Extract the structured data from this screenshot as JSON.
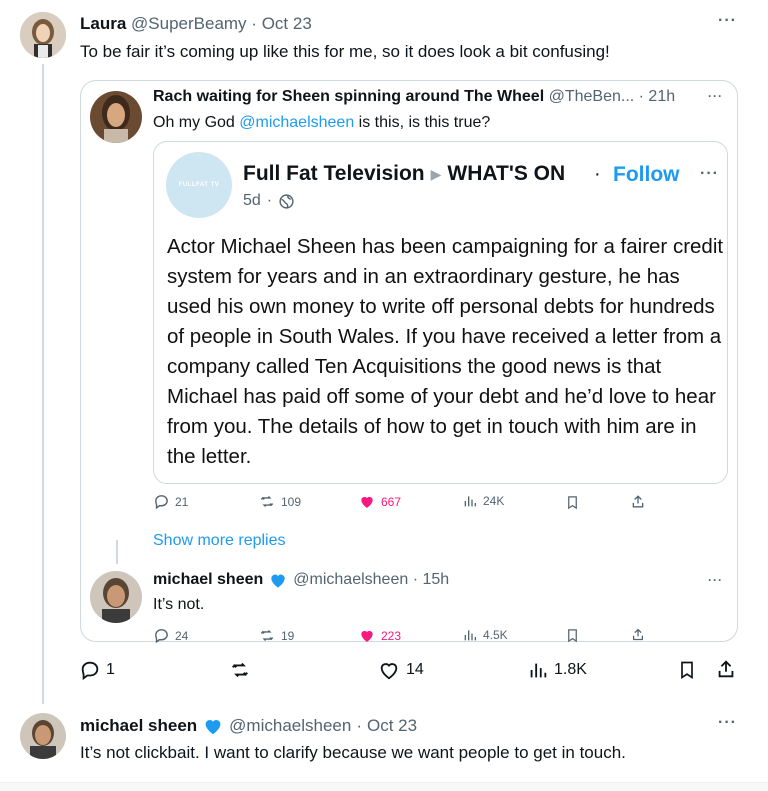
{
  "tweet1": {
    "name": "Laura",
    "handle": "@SuperBeamy",
    "sep": "·",
    "time": "Oct 23",
    "text": "To be fair it’s coming up like this for me, so it does look a bit confusing!",
    "more": "···"
  },
  "quoted": {
    "name": "Rach waiting for Sheen spinning around The Wheel",
    "handle_time": "@TheBen... · 21h",
    "more": "···",
    "text_prefix": "Oh my God ",
    "mention": "@michaelsheen",
    "text_suffix": " is this, is this true?"
  },
  "embedded": {
    "avatar_text": "FULLFAT TV",
    "name": "Full Fat Television",
    "arrow": "▶",
    "community": "WHAT'S ON",
    "dot": "·",
    "follow": "Follow",
    "more": "···",
    "time": "5d",
    "sep": "·",
    "body": "Actor Michael Sheen has been campaigning for a fairer credit system for years and in an extraordinary gesture, he has used his own money to write off personal debts for hundreds of people in South Wales. If you have received a letter from a company called Ten Acquisitions the good news is that Michael has paid off some of your debt and he’d love to hear from you.  The details of how to get in touch with him are in the letter."
  },
  "quoted_actions": {
    "replies": "21",
    "reposts": "109",
    "likes": "667",
    "views": "24K"
  },
  "show_more": "Show more replies",
  "reply": {
    "name": "michael sheen",
    "handle_time": "@michaelsheen · 15h",
    "more": "···",
    "text": "It’s not.",
    "replies": "24",
    "reposts": "19",
    "likes": "223",
    "views": "4.5K"
  },
  "tweet1_actions": {
    "replies": "1",
    "likes": "14",
    "views": "1.8K"
  },
  "tweet2": {
    "name": "michael sheen",
    "handle": "@michaelsheen",
    "sep": "·",
    "time": "Oct 23",
    "text": "It’s not clickbait. I want to clarify because we want people to get in touch.",
    "more": "···"
  },
  "colors": {
    "accent": "#1d9bf0",
    "like": "#f91880",
    "muted": "#536471",
    "verified": "#1d9bf0"
  }
}
